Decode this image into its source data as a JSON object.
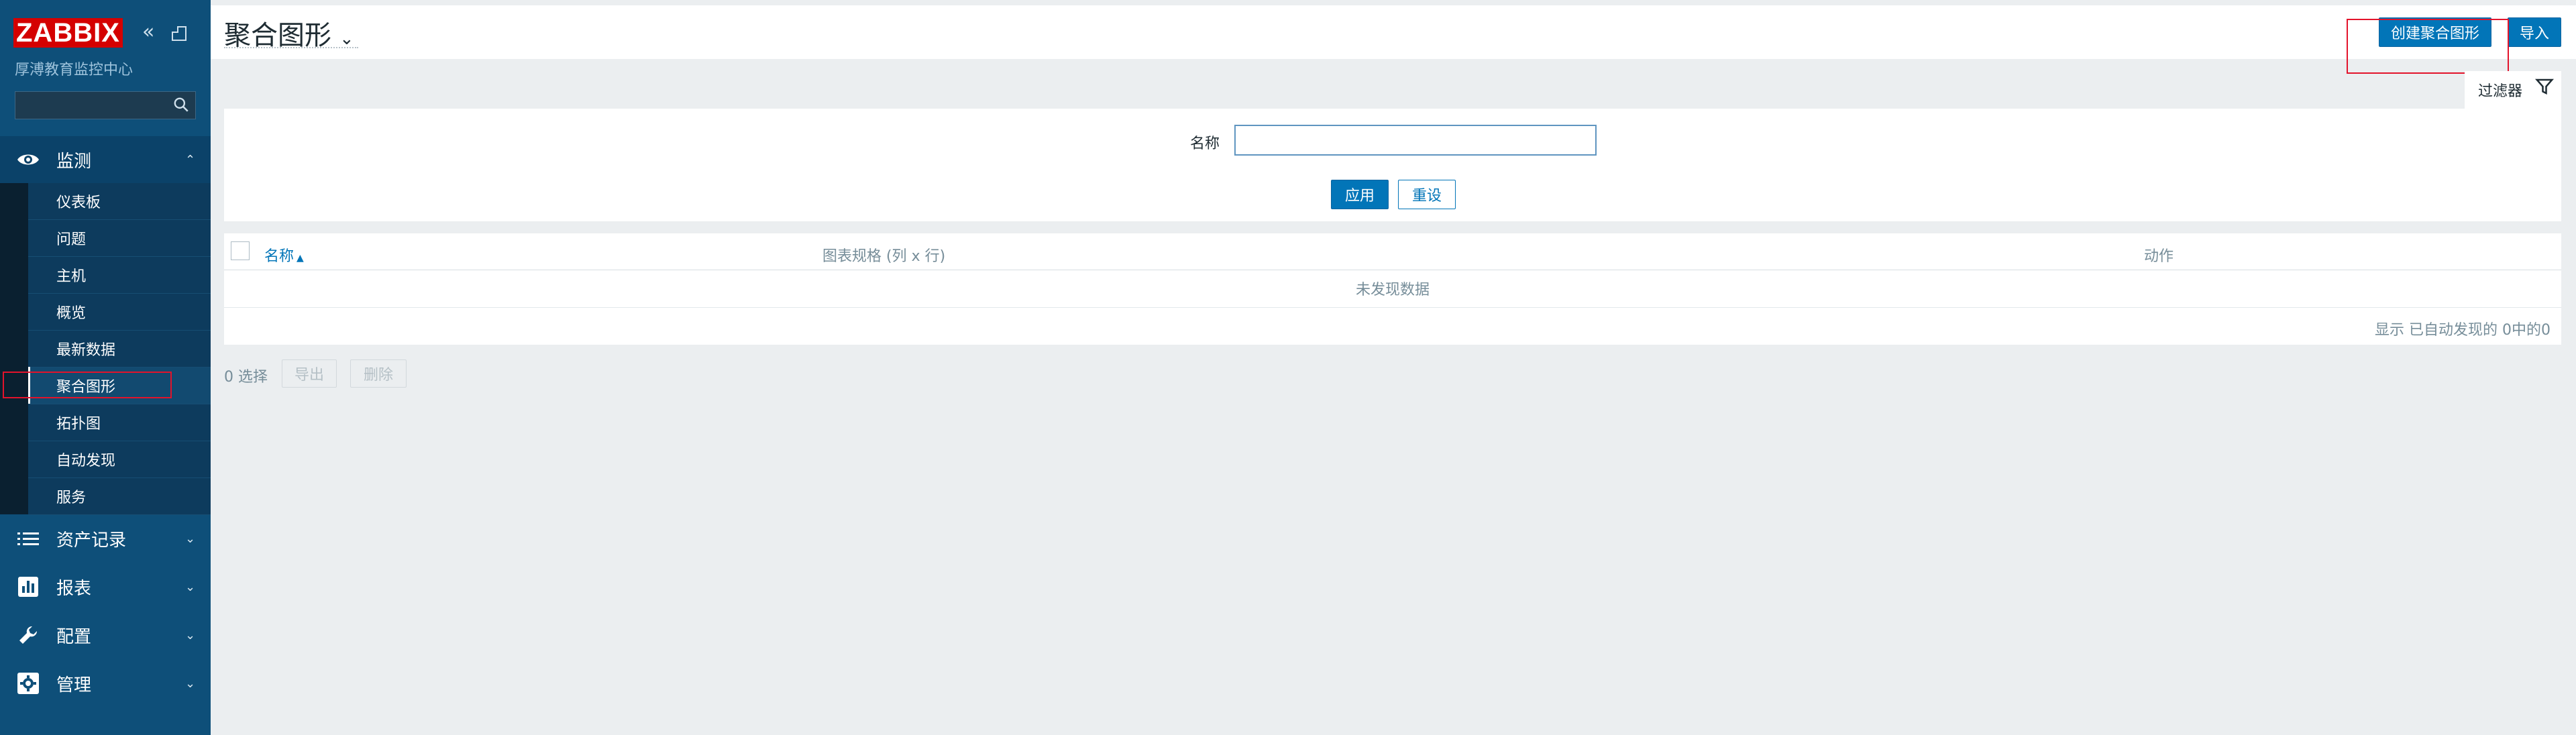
{
  "sidebar": {
    "logo": "ZABBIX",
    "server_name": "厚溥教育监控中心",
    "search": {
      "value": "",
      "placeholder": ""
    },
    "sections": [
      {
        "label": "监测",
        "icon": "eye-icon",
        "expanded": true
      },
      {
        "label": "资产记录",
        "icon": "list-icon",
        "expanded": false
      },
      {
        "label": "报表",
        "icon": "bar-chart-icon",
        "expanded": false
      },
      {
        "label": "配置",
        "icon": "wrench-icon",
        "expanded": false
      },
      {
        "label": "管理",
        "icon": "gear-icon",
        "expanded": false
      }
    ],
    "monitoring_items": [
      "仪表板",
      "问题",
      "主机",
      "概览",
      "最新数据",
      "聚合图形",
      "拓扑图",
      "自动发现",
      "服务"
    ],
    "selected_item": "聚合图形"
  },
  "header": {
    "title": "聚合图形",
    "create_button": "创建聚合图形",
    "import_button": "导入"
  },
  "filter": {
    "tab_label": "过滤器",
    "name_label": "名称",
    "name_value": "",
    "apply_button": "应用",
    "reset_button": "重设"
  },
  "table": {
    "columns": [
      "名称",
      "图表规格 (列 x 行)",
      "动作"
    ],
    "sort_indicator": "▲",
    "empty_message": "未发现数据",
    "paging_info": "显示 已自动发现的 0中的0"
  },
  "footer": {
    "selected_count": "0 选择",
    "export_button": "导出",
    "delete_button": "删除"
  },
  "colors": {
    "sidebar_bg": "#0e4f79",
    "accent": "#0275b8",
    "logo_red": "#d40000",
    "annotation_red": "#e3132b"
  }
}
